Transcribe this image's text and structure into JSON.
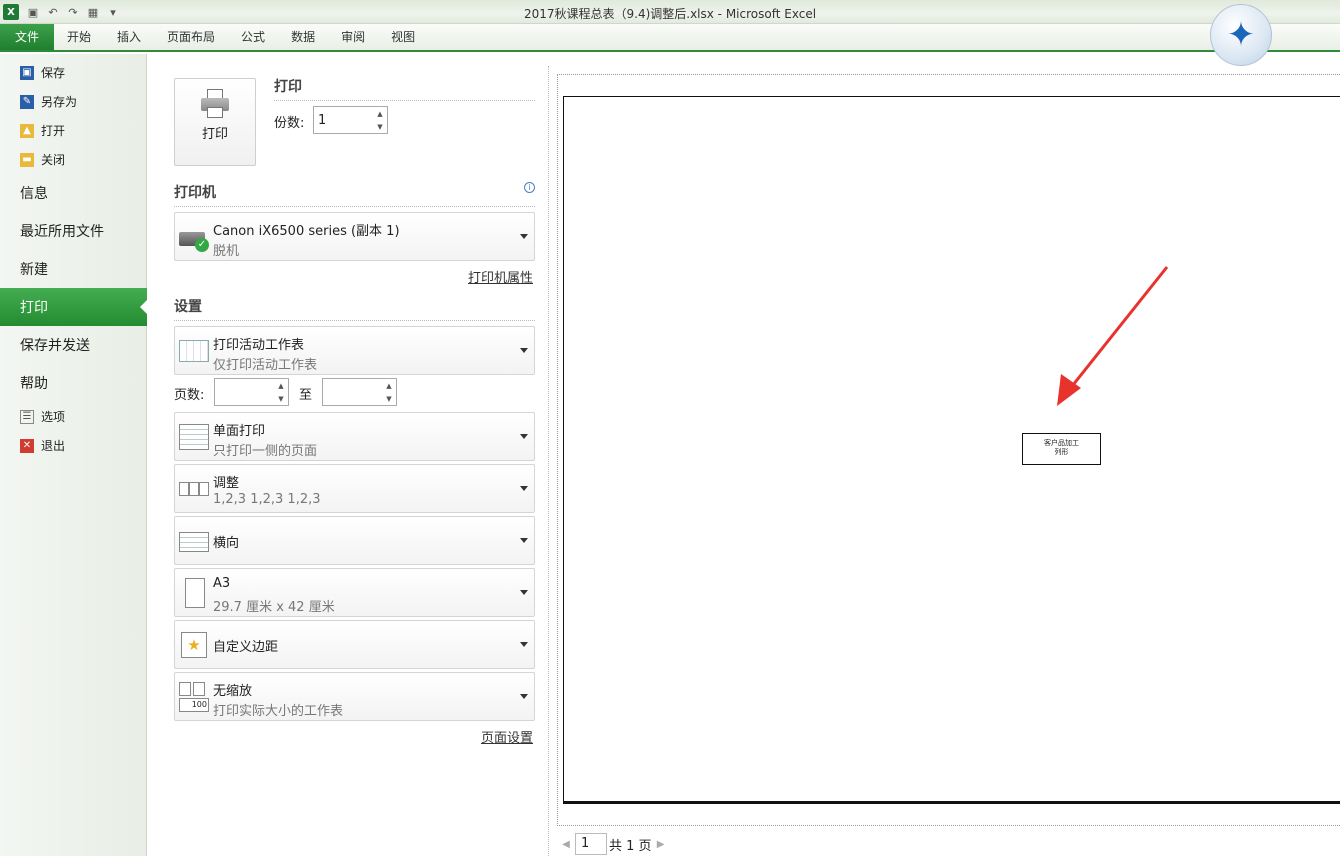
{
  "window": {
    "title": "2017秋课程总表（9.4)调整后.xlsx  -  Microsoft Excel",
    "app_logo": "X"
  },
  "ribbon": {
    "tabs": [
      "文件",
      "开始",
      "插入",
      "页面布局",
      "公式",
      "数据",
      "审阅",
      "视图"
    ]
  },
  "backstage": {
    "save": "保存",
    "save_as": "另存为",
    "open": "打开",
    "close": "关闭",
    "info": "信息",
    "recent": "最近所用文件",
    "new": "新建",
    "print": "打印",
    "save_send": "保存并发送",
    "help": "帮助",
    "options": "选项",
    "exit": "退出"
  },
  "print_panel": {
    "print_button": "打印",
    "print_title": "打印",
    "copies_label": "份数:",
    "copies_value": "1",
    "printer_title": "打印机",
    "printer_name": "Canon iX6500 series (副本 1)",
    "printer_status": "脱机",
    "printer_properties": "打印机属性",
    "settings_title": "设置",
    "scope_main": "打印活动工作表",
    "scope_sub": "仅打印活动工作表",
    "pages_label": "页数:",
    "pages_from": "",
    "pages_to_label": "至",
    "pages_to": "",
    "sides_main": "单面打印",
    "sides_sub": "只打印一侧的页面",
    "collate_main": "调整",
    "collate_sub": "1,2,3    1,2,3    1,2,3",
    "orientation_main": "横向",
    "paper_main": "A3",
    "paper_sub": "29.7 厘米 x 42 厘米",
    "margins_main": "自定义边距",
    "scaling_main": "无缩放",
    "scaling_sub": "打印实际大小的工作表",
    "page_setup": "页面设置"
  },
  "preview": {
    "cell_line1": "客户品加工",
    "cell_line2": "列形",
    "current_page": "1",
    "total_pages": "共 1 页"
  },
  "colors": {
    "file_tab": "#2a8f38",
    "active_nav": "#2f9a3d",
    "annotation_arrow": "#e8322c"
  }
}
